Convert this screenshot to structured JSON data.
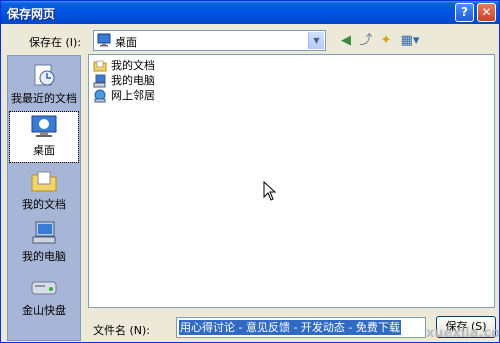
{
  "title": "保存网页",
  "savein": {
    "label": "保存在 (I):",
    "value": "桌面"
  },
  "places": [
    {
      "label": "我最近的文档",
      "icon": "recent-documents-icon"
    },
    {
      "label": "桌面",
      "icon": "desktop-icon"
    },
    {
      "label": "我的文档",
      "icon": "my-documents-icon"
    },
    {
      "label": "我的电脑",
      "icon": "my-computer-icon"
    },
    {
      "label": "金山快盘",
      "icon": "kuaipan-drive-icon"
    }
  ],
  "files": [
    {
      "label": "我的文档",
      "icon": "folder-icon"
    },
    {
      "label": "我的电脑",
      "icon": "computer-icon"
    },
    {
      "label": "网上邻居",
      "icon": "network-icon"
    }
  ],
  "filename": {
    "label": "文件名 (N):",
    "value": "用心得讨论 - 意见反馈 - 开发动态 - 免费下载"
  },
  "buttons": {
    "save": "保存 (S)"
  },
  "watermark": "xuexila.com",
  "colors": {
    "titlebar": "#0054E3",
    "selection": "#316AC5",
    "places_bg": "#A7B6D6"
  }
}
